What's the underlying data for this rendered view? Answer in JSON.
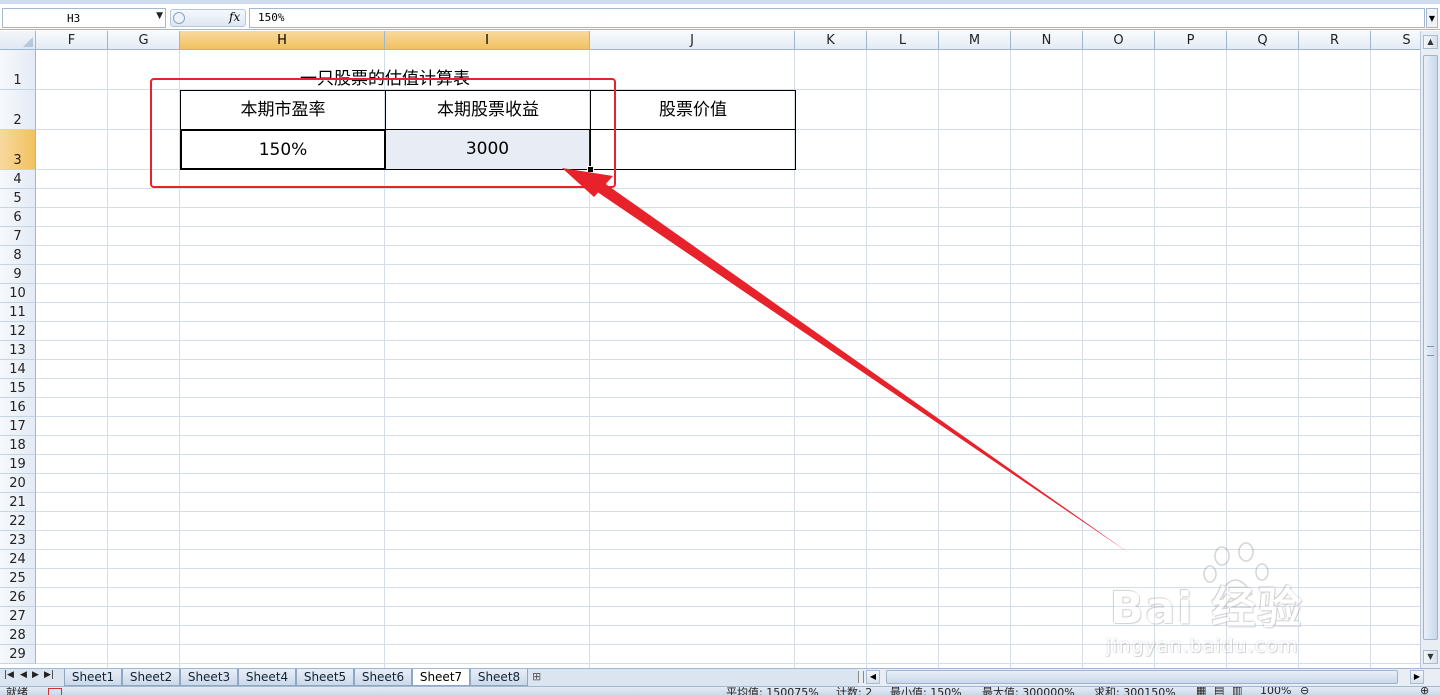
{
  "formula_bar": {
    "name_box": "H3",
    "fx_icon": "fx",
    "formula": "150%"
  },
  "columns": [
    "F",
    "G",
    "H",
    "I",
    "J",
    "K",
    "L",
    "M",
    "N",
    "O",
    "P",
    "Q",
    "R",
    "S"
  ],
  "selected_columns": [
    "H",
    "I"
  ],
  "rows": [
    "1",
    "2",
    "3",
    "4",
    "5",
    "6",
    "7",
    "8",
    "9",
    "10",
    "11",
    "12",
    "13",
    "14",
    "15",
    "16",
    "17",
    "18",
    "19",
    "20",
    "21",
    "22",
    "23",
    "24",
    "25",
    "26",
    "27",
    "28",
    "29"
  ],
  "selected_rows": [
    "3"
  ],
  "table": {
    "title": "一只股票的估值计算表",
    "headers": [
      "本期市盈率",
      "本期股票收益",
      "股票价值"
    ],
    "values": [
      "150%",
      "3000",
      ""
    ]
  },
  "sheet_tabs": [
    "Sheet1",
    "Sheet2",
    "Sheet3",
    "Sheet4",
    "Sheet5",
    "Sheet6",
    "Sheet7",
    "Sheet8"
  ],
  "active_sheet": "Sheet7",
  "status_bar": {
    "ready": "就绪",
    "average": "平均值: 150075%",
    "count": "计数: 2",
    "min": "最小值: 150%",
    "max": "最大值: 300000%",
    "sum": "求和: 300150%",
    "zoom": "100%"
  },
  "watermark": {
    "brand": "Bai  经验",
    "url": "jingyan.baidu.com"
  },
  "annotation_color": "#e8222a"
}
